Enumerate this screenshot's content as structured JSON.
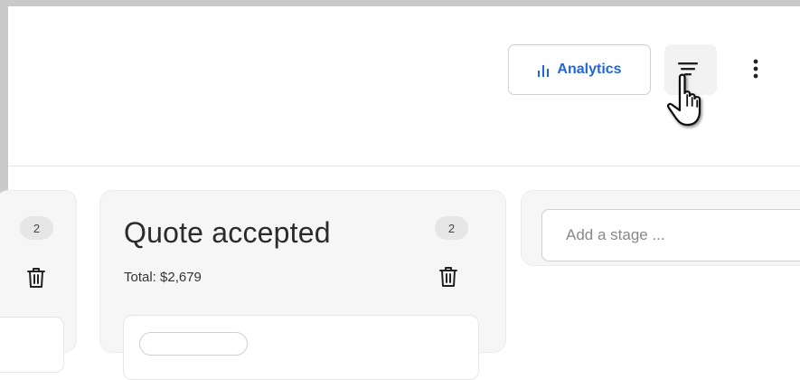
{
  "toolbar": {
    "analytics_label": "Analytics",
    "analytics_icon": "bar-chart-icon",
    "filter_icon": "filter-icon",
    "more_icon": "more-vertical-icon"
  },
  "board": {
    "columns": [
      {
        "count": "2"
      },
      {
        "title": "Quote accepted",
        "total": "Total: $2,679",
        "count": "2"
      }
    ],
    "add_stage": {
      "placeholder": "Add a stage ..."
    }
  },
  "colors": {
    "accent": "#2266dd",
    "column_bg": "#f6f6f6",
    "badge_bg": "#e6e6e6",
    "border": "#cfcfd4"
  }
}
